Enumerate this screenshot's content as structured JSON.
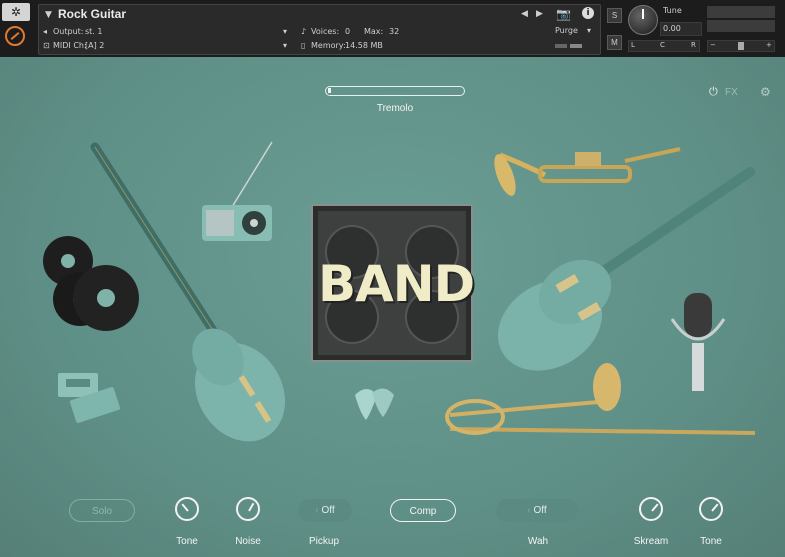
{
  "header": {
    "instrument_name": "Rock Guitar",
    "output_label": "Output:",
    "output_value": "st. 1",
    "midi_label": "MIDI Ch:",
    "midi_value": "[A]  2",
    "voices_label": "Voices:",
    "voices_value": "0",
    "max_label": "Max:",
    "max_value": "32",
    "memory_label": "Memory:",
    "memory_value": "14.58 MB",
    "purge_label": "Purge",
    "solo_btn": "S",
    "mute_btn": "M",
    "tune_label": "Tune",
    "tune_value": "0.00",
    "pan_left": "L",
    "pan_center": "C",
    "pan_right": "R",
    "vol_minus": "−",
    "vol_plus": "+"
  },
  "main": {
    "tremolo_label": "Tremolo",
    "fx_label": "FX",
    "amp_text": "BAND"
  },
  "controls": {
    "solo": "Solo",
    "tone1": "Tone",
    "noise": "Noise",
    "pickup_value": "Off",
    "pickup_label": "Pickup",
    "comp": "Comp",
    "wah_value": "Off",
    "wah_label": "Wah",
    "skream": "Skream",
    "tone2": "Tone"
  },
  "colors": {
    "background": "#62938a",
    "header": "#1c1c1c",
    "accent": "#e07a2c",
    "teal_object": "#6fa69c"
  }
}
